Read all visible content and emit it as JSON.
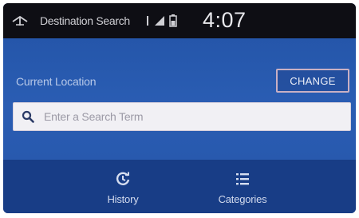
{
  "status_bar": {
    "app_title": "Destination Search",
    "time": "4:07",
    "icons": [
      "navigation-app-icon",
      "bluetooth-icon",
      "signal-icon",
      "battery-icon"
    ]
  },
  "location": {
    "label": "Current Location",
    "change_label": "CHANGE"
  },
  "search": {
    "placeholder": "Enter a Search Term",
    "icon": "search-icon"
  },
  "bottom_nav": {
    "items": [
      {
        "label": "History",
        "icon": "history-icon"
      },
      {
        "label": "Categories",
        "icon": "list-icon"
      }
    ]
  },
  "colors": {
    "status_bar_bg": "#0e0e14",
    "main_bg": "#2556aa",
    "nav_bg": "#183d86",
    "search_bg": "#f1f0f4"
  }
}
